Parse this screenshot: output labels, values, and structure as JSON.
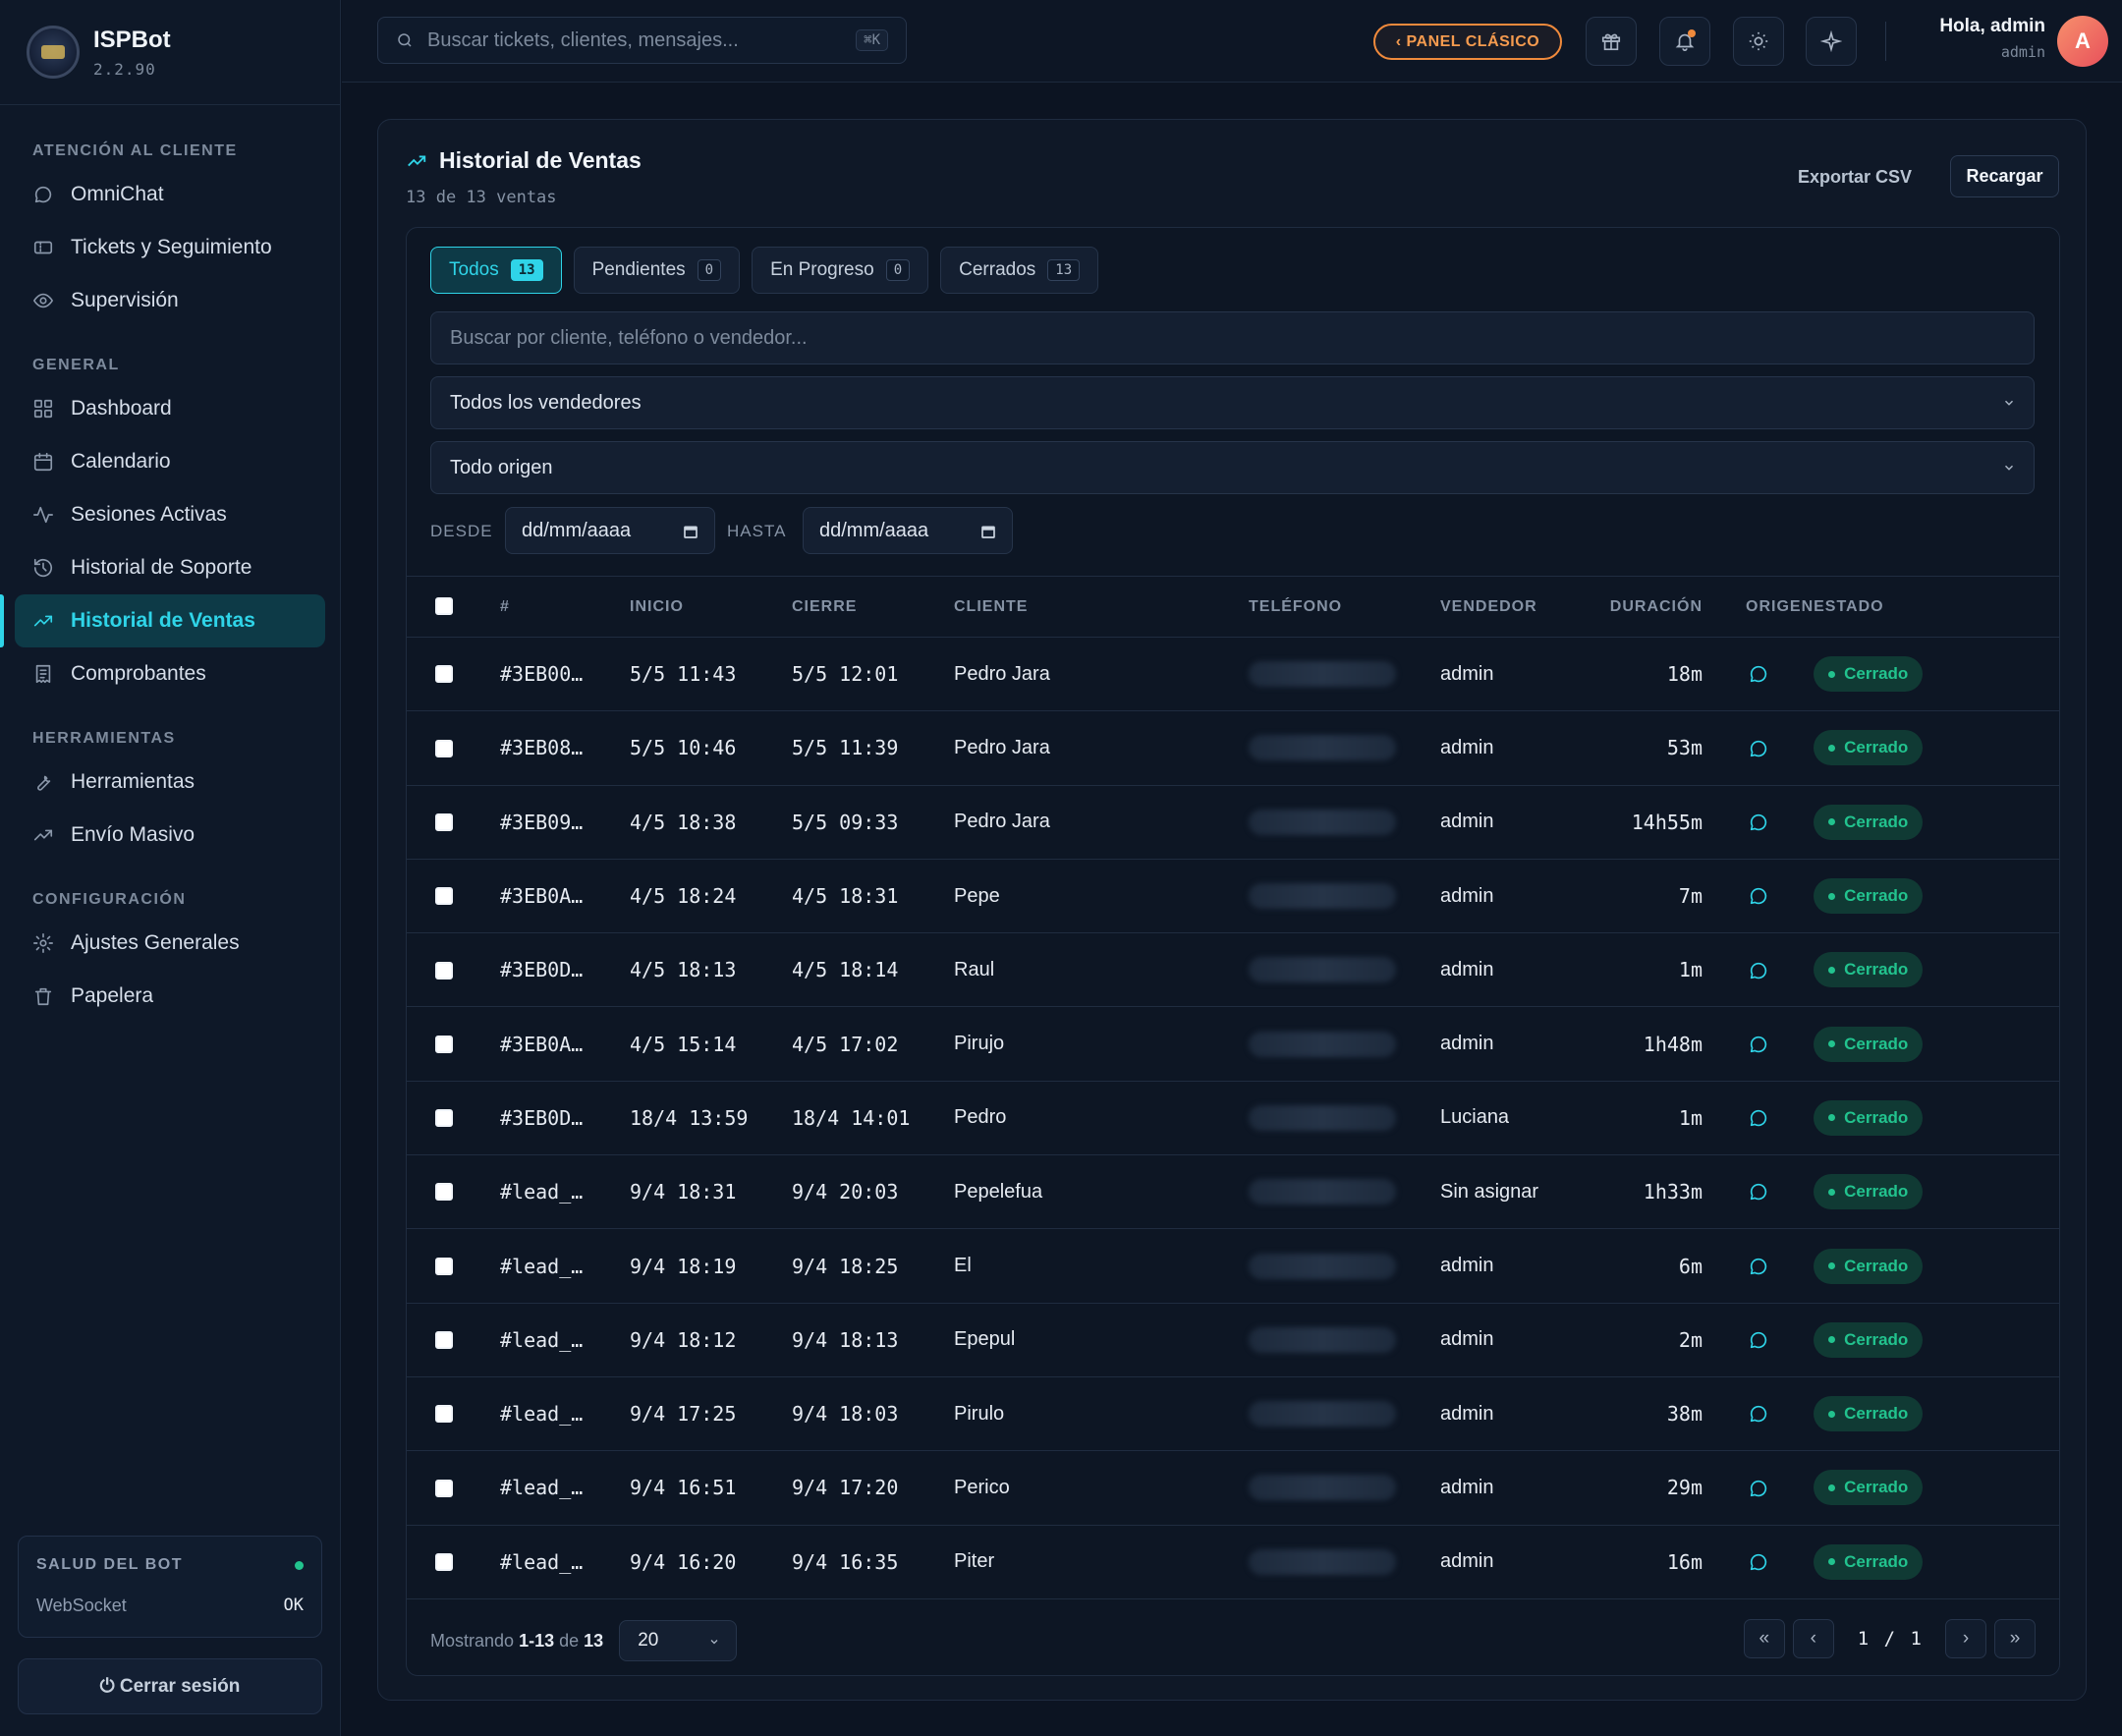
{
  "app": {
    "name": "ISPBot",
    "version": "2.2.90"
  },
  "sidebar": {
    "sections": [
      {
        "title": "ATENCIÓN AL CLIENTE",
        "items": [
          {
            "label": "OmniChat",
            "icon": "chat-bubble-icon"
          },
          {
            "label": "Tickets y Seguimiento",
            "icon": "ticket-icon"
          },
          {
            "label": "Supervisión",
            "icon": "eye-icon"
          }
        ]
      },
      {
        "title": "GENERAL",
        "items": [
          {
            "label": "Dashboard",
            "icon": "grid-icon"
          },
          {
            "label": "Calendario",
            "icon": "calendar-icon"
          },
          {
            "label": "Sesiones Activas",
            "icon": "activity-icon"
          },
          {
            "label": "Historial de Soporte",
            "icon": "history-icon"
          },
          {
            "label": "Historial de Ventas",
            "icon": "trending-up-icon",
            "active": true
          },
          {
            "label": "Comprobantes",
            "icon": "receipt-icon"
          }
        ]
      },
      {
        "title": "HERRAMIENTAS",
        "items": [
          {
            "label": "Herramientas",
            "icon": "wrench-icon"
          },
          {
            "label": "Envío Masivo",
            "icon": "trending-up-icon"
          }
        ]
      },
      {
        "title": "CONFIGURACIÓN",
        "items": [
          {
            "label": "Ajustes Generales",
            "icon": "gear-icon"
          },
          {
            "label": "Papelera",
            "icon": "trash-icon"
          }
        ]
      }
    ],
    "health": {
      "title": "SALUD DEL BOT",
      "label": "WebSocket",
      "value": "OK"
    },
    "logout_label": "⏻ Cerrar sesión"
  },
  "topbar": {
    "search_placeholder": "Buscar tickets, clientes, mensajes...",
    "shortcut": "⌘K",
    "classic_panel_label": "‹ PANEL CLÁSICO",
    "greeting": "Hola, admin",
    "role": "admin",
    "avatar_initial": "A"
  },
  "page": {
    "title": "Historial de Ventas",
    "subtitle": "13 de 13 ventas",
    "export_label": "Exportar CSV",
    "reload_label": "Recargar",
    "tabs": [
      {
        "label": "Todos",
        "count": "13",
        "active": true
      },
      {
        "label": "Pendientes",
        "count": "0"
      },
      {
        "label": "En Progreso",
        "count": "0"
      },
      {
        "label": "Cerrados",
        "count": "13"
      }
    ],
    "filter_search_placeholder": "Buscar por cliente, teléfono o vendedor...",
    "vendor_select": "Todos los vendedores",
    "origin_select": "Todo origen",
    "date_from_label": "DESDE",
    "date_to_label": "HASTA",
    "date_placeholder": "dd/mm/aaaa"
  },
  "table": {
    "columns": [
      "#",
      "INICIO",
      "CIERRE",
      "CLIENTE",
      "TELÉFONO",
      "VENDEDOR",
      "DURACIÓN",
      "ORIGEN",
      "ESTADO"
    ],
    "rows": [
      {
        "id": "#3EB00…",
        "start": "5/5 11:43",
        "end": "5/5 12:01",
        "client": "Pedro Jara",
        "seller": "admin",
        "duration": "18m",
        "status": "Cerrado"
      },
      {
        "id": "#3EB08…",
        "start": "5/5 10:46",
        "end": "5/5 11:39",
        "client": "Pedro Jara",
        "seller": "admin",
        "duration": "53m",
        "status": "Cerrado"
      },
      {
        "id": "#3EB09…",
        "start": "4/5 18:38",
        "end": "5/5 09:33",
        "client": "Pedro Jara",
        "seller": "admin",
        "duration": "14h55m",
        "status": "Cerrado"
      },
      {
        "id": "#3EB0A…",
        "start": "4/5 18:24",
        "end": "4/5 18:31",
        "client": "Pepe",
        "seller": "admin",
        "duration": "7m",
        "status": "Cerrado"
      },
      {
        "id": "#3EB0D…",
        "start": "4/5 18:13",
        "end": "4/5 18:14",
        "client": "Raul",
        "seller": "admin",
        "duration": "1m",
        "status": "Cerrado"
      },
      {
        "id": "#3EB0A…",
        "start": "4/5 15:14",
        "end": "4/5 17:02",
        "client": "Pirujo",
        "seller": "admin",
        "duration": "1h48m",
        "status": "Cerrado"
      },
      {
        "id": "#3EB0D…",
        "start": "18/4 13:59",
        "end": "18/4 14:01",
        "client": "Pedro",
        "seller": "Luciana",
        "duration": "1m",
        "status": "Cerrado"
      },
      {
        "id": "#lead_…",
        "start": "9/4 18:31",
        "end": "9/4 20:03",
        "client": "Pepelefua",
        "seller": "Sin asignar",
        "duration": "1h33m",
        "status": "Cerrado"
      },
      {
        "id": "#lead_…",
        "start": "9/4 18:19",
        "end": "9/4 18:25",
        "client": "El",
        "seller": "admin",
        "duration": "6m",
        "status": "Cerrado"
      },
      {
        "id": "#lead_…",
        "start": "9/4 18:12",
        "end": "9/4 18:13",
        "client": "Epepul",
        "seller": "admin",
        "duration": "2m",
        "status": "Cerrado"
      },
      {
        "id": "#lead_…",
        "start": "9/4 17:25",
        "end": "9/4 18:03",
        "client": "Pirulo",
        "seller": "admin",
        "duration": "38m",
        "status": "Cerrado"
      },
      {
        "id": "#lead_…",
        "start": "9/4 16:51",
        "end": "9/4 17:20",
        "client": "Perico",
        "seller": "admin",
        "duration": "29m",
        "status": "Cerrado"
      },
      {
        "id": "#lead_…",
        "start": "9/4 16:20",
        "end": "9/4 16:35",
        "client": "Piter",
        "seller": "admin",
        "duration": "16m",
        "status": "Cerrado"
      }
    ]
  },
  "pagination": {
    "showing_prefix": "Mostrando",
    "range": "1-13",
    "of_word": "de",
    "total": "13",
    "per_page": "20",
    "page_indicator": "1 / 1",
    "first": "«",
    "prev": "‹",
    "next": "›",
    "last": "»"
  },
  "colors": {
    "accent": "#2fd4e8",
    "warning": "#f08a3c",
    "success": "#22c38e",
    "background": "#0c1422"
  }
}
